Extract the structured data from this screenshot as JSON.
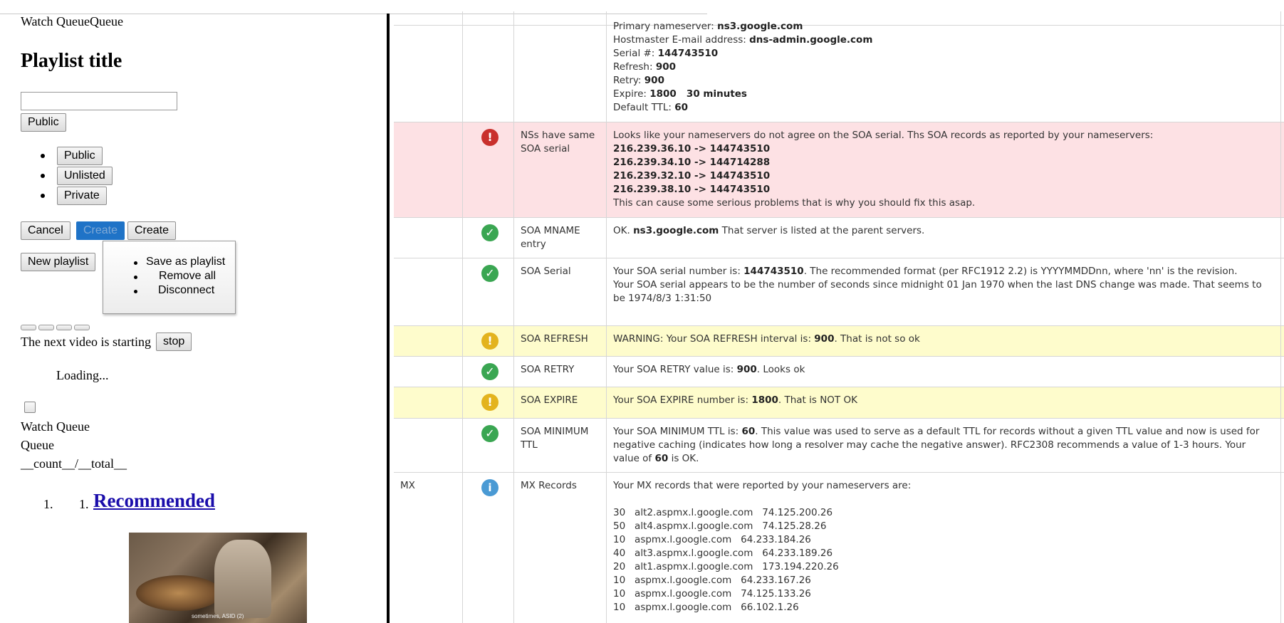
{
  "left": {
    "watch_queue_header": "Watch QueueQueue",
    "playlist_title": "Playlist title",
    "title_input_value": "",
    "privacy_button": "Public",
    "privacy_options": [
      "Public",
      "Unlisted",
      "Private"
    ],
    "cancel_label": "Cancel",
    "create_highlight_label": "Create",
    "create_label": "Create",
    "new_playlist_label": "New playlist",
    "menu_items": [
      "Save as playlist",
      "Remove all",
      "Disconnect"
    ],
    "next_video_text": "The next video is starting",
    "stop_label": "stop",
    "loading_text": "Loading...",
    "watch_queue_label": "Watch Queue",
    "queue_label": "Queue",
    "count_text": "__count__/__total__",
    "list_outer_number": "1.",
    "list_inner_number": "1.",
    "recommended_link": "Recommended",
    "thumb_caption": "sometimes, ASID (2)"
  },
  "table": {
    "soa_top": {
      "primary_ns_label": "Primary nameserver: ",
      "primary_ns": "ns3.google.com",
      "hostmaster_label": "Hostmaster E-mail address: ",
      "hostmaster": "dns-admin.google.com",
      "serial_label": "Serial #: ",
      "serial": "144743510",
      "refresh_label": "Refresh: ",
      "refresh": "900",
      "retry_label": "Retry: ",
      "retry": "900",
      "expire_label": "Expire: ",
      "expire": "1800   30 minutes",
      "ttl_label": "Default TTL: ",
      "ttl": "60"
    },
    "ns_soa": {
      "status": "error",
      "icon": "exclamation-icon",
      "test": "NSs have same SOA serial",
      "intro": "Looks like your nameservers do not agree on the SOA serial. Ths SOA records as reported by your nameservers:",
      "lines": [
        "216.239.36.10 -> 144743510",
        "216.239.34.10 -> 144714288",
        "216.239.32.10 -> 144743510",
        "216.239.38.10 -> 144743510"
      ],
      "outro": "This can cause some serious problems that is why you should fix this asap."
    },
    "mname": {
      "status": "ok",
      "icon": "check-icon",
      "test": "SOA MNAME entry",
      "pre": "OK. ",
      "bold": "ns3.google.com",
      "post": " That server is listed at the parent servers."
    },
    "serial": {
      "status": "ok",
      "icon": "check-icon",
      "test": "SOA Serial",
      "pre": "Your SOA serial number is: ",
      "bold": "144743510",
      "post": ". The recommended format (per RFC1912 2.2) is YYYYMMDDnn, where 'nn' is the revision.",
      "line2": "Your SOA serial appears to be the number of seconds since midnight 01 Jan 1970 when the last DNS change was made. That seems to be 1974/8/3 1:31:50"
    },
    "refresh": {
      "status": "warning",
      "icon": "exclamation-icon",
      "test": "SOA REFRESH",
      "pre": "WARNING: Your SOA REFRESH interval is: ",
      "bold": "900",
      "post": ". That is not so ok"
    },
    "retry": {
      "status": "ok",
      "icon": "check-icon",
      "test": "SOA RETRY",
      "pre": "Your SOA RETRY value is: ",
      "bold": "900",
      "post": ". Looks ok"
    },
    "expire": {
      "status": "warning",
      "icon": "exclamation-icon",
      "test": "SOA EXPIRE",
      "pre": "Your SOA EXPIRE number is: ",
      "bold": "1800",
      "post": ". That is NOT OK"
    },
    "minimum": {
      "status": "ok",
      "icon": "check-icon",
      "test": "SOA MINIMUM TTL",
      "pre": "Your SOA MINIMUM TTL is: ",
      "bold": "60",
      "mid": ". This value was used to serve as a default TTL for records without a given TTL value and now is used for negative caching (indicates how long a resolver may cache the negative answer). RFC2308 recommends a value of 1-3 hours. Your value of ",
      "bold2": "60",
      "post": " is OK."
    },
    "mx": {
      "category": "MX",
      "status": "info",
      "icon": "info-icon",
      "test": "MX Records",
      "intro": "Your MX records that were reported by your nameservers are:",
      "records": [
        "30   alt2.aspmx.l.google.com   74.125.200.26",
        "50   alt4.aspmx.l.google.com   74.125.28.26",
        "10   aspmx.l.google.com   64.233.184.26",
        "40   alt3.aspmx.l.google.com   64.233.189.26",
        "20   alt1.aspmx.l.google.com   173.194.220.26",
        "10   aspmx.l.google.com   64.233.167.26",
        "10   aspmx.l.google.com   74.125.133.26",
        "10   aspmx.l.google.com   66.102.1.26"
      ]
    }
  },
  "colors": {
    "error_row": "#fde1e4",
    "warning_row": "#fefccc",
    "ok_icon": "#3aa652",
    "error_icon": "#c9302c",
    "warning_icon": "#e3b31e",
    "info_icon": "#4a9ad4",
    "create_highlight": "#1f73c7",
    "link": "#1a0dab"
  }
}
